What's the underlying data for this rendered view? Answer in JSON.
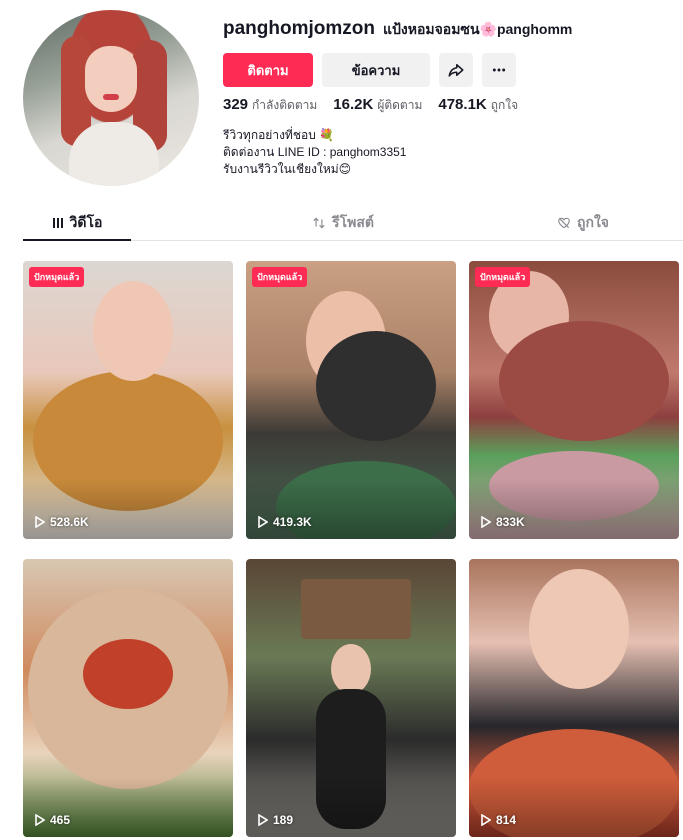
{
  "profile": {
    "username": "panghomjomzon",
    "nickname": "แป้งหอมจอมซน🌸panghomm",
    "follow_label": "ติดตาม",
    "message_label": "ข้อความ"
  },
  "stats": {
    "following_count": "329",
    "following_label": "กำลังติดตาม",
    "followers_count": "16.2K",
    "followers_label": "ผู้ติดตาม",
    "likes_count": "478.1K",
    "likes_label": "ถูกใจ"
  },
  "bio": {
    "line1": "รีวิวทุกอย่างที่ชอบ 💐",
    "line2": "ติดต่องาน LINE ID : panghom3351",
    "line3": "รับงานรีวิวในเชียงใหม่😊"
  },
  "tabs": [
    {
      "label": "วิดีโอ",
      "icon": "grid-lines-icon",
      "active": true
    },
    {
      "label": "รีโพสต์",
      "icon": "repost-icon",
      "active": false
    },
    {
      "label": "ถูกใจ",
      "icon": "heart-hidden-icon",
      "active": false
    }
  ],
  "videos": [
    {
      "views": "528.6K",
      "pinned_label": "ปักหมุดแล้ว"
    },
    {
      "views": "419.3K",
      "pinned_label": "ปักหมุดแล้ว"
    },
    {
      "views": "833K",
      "pinned_label": "ปักหมุดแล้ว"
    },
    {
      "views": "465",
      "pinned_label": ""
    },
    {
      "views": "189",
      "pinned_label": ""
    },
    {
      "views": "814",
      "pinned_label": ""
    }
  ],
  "colors": {
    "accent": "#fe2c55",
    "text": "#161823",
    "secondary_text": "#5b5c63",
    "button_gray": "#f1f1f2"
  }
}
